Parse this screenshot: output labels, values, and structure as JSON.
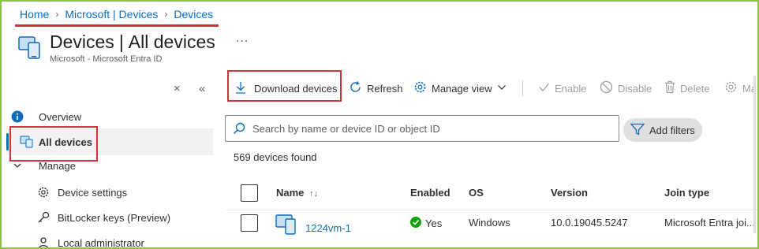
{
  "breadcrumb": {
    "items": [
      "Home",
      "Microsoft | Devices",
      "Devices"
    ]
  },
  "header": {
    "title": "Devices",
    "title_separator": "|",
    "title_section": "All devices",
    "subtitle": "Microsoft - Microsoft Entra ID",
    "more_label": "..."
  },
  "sidebar": {
    "close_label": "×",
    "collapse_label": "«",
    "items": [
      {
        "label": "Overview",
        "icon": "info-icon"
      },
      {
        "label": "All devices",
        "icon": "devices-icon",
        "selected": true
      },
      {
        "label": "Manage",
        "icon": "chevron-down-icon",
        "group": true
      },
      {
        "label": "Device settings",
        "icon": "gear-icon"
      },
      {
        "label": "BitLocker keys (Preview)",
        "icon": "key-icon"
      },
      {
        "label": "Local administrator",
        "icon": "local-admin-icon"
      }
    ]
  },
  "toolbar": {
    "download_label": "Download devices",
    "refresh_label": "Refresh",
    "manage_view_label": "Manage view",
    "enable_label": "Enable",
    "disable_label": "Disable",
    "delete_label": "Delete",
    "more_label": "Ma"
  },
  "search": {
    "placeholder": "Search by name or device ID or object ID",
    "value": ""
  },
  "filters": {
    "add_label": "Add filters"
  },
  "results": {
    "count_text": "569 devices found"
  },
  "table": {
    "columns": [
      "Name",
      "Enabled",
      "OS",
      "Version",
      "Join type"
    ],
    "sort_indicator": "↑↓",
    "rows": [
      {
        "name": "1224vm-1",
        "enabled": "Yes",
        "os": "Windows",
        "version": "10.0.19045.5247",
        "join_type": "Microsoft Entra joi..."
      }
    ]
  },
  "colors": {
    "accent": "#0f6cbd",
    "highlight": "#d13438",
    "success": "#13a10e",
    "frame": "#8bc34a"
  }
}
